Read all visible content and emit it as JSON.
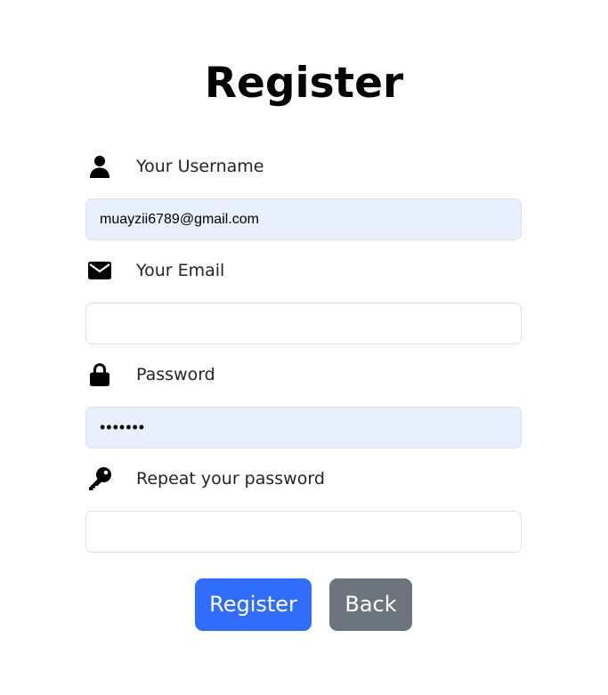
{
  "page": {
    "title": "Register"
  },
  "form": {
    "username": {
      "label": "Your Username",
      "value": "muayzii6789@gmail.com",
      "icon": "user-icon"
    },
    "email": {
      "label": "Your Email",
      "value": "",
      "icon": "envelope-icon"
    },
    "password": {
      "label": "Password",
      "value": "•••••••",
      "icon": "lock-icon"
    },
    "repeat_password": {
      "label": "Repeat your password",
      "value": "",
      "icon": "key-icon"
    }
  },
  "actions": {
    "register_label": "Register",
    "back_label": "Back"
  },
  "colors": {
    "primary": "#2f6dfa",
    "secondary": "#6c757d",
    "autofill_background": "#e8f0fe",
    "input_border": "#dee2e6"
  }
}
